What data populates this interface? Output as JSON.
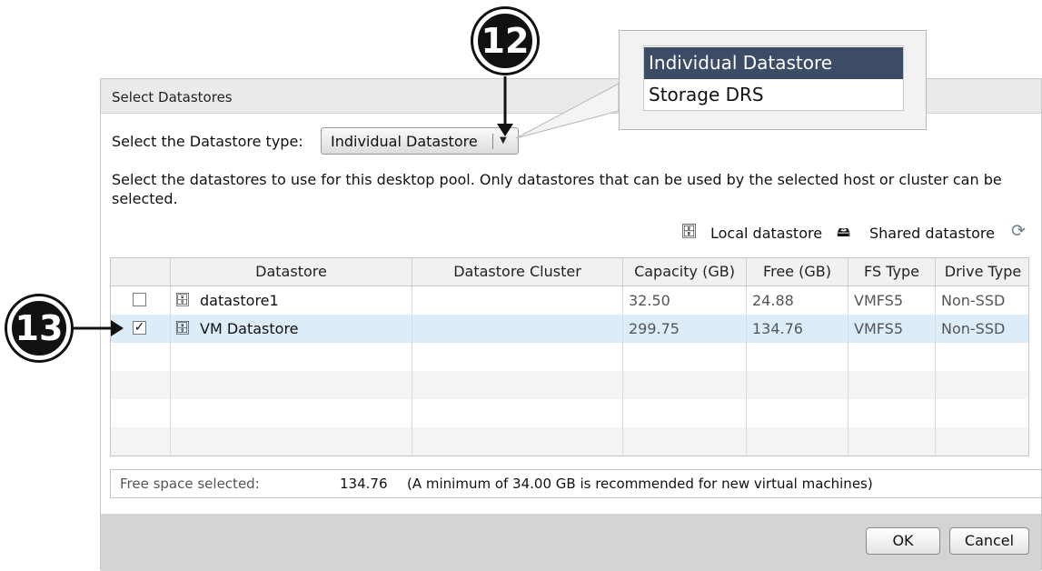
{
  "dialog": {
    "title": "Select Datastores",
    "type_label": "Select the Datastore type:",
    "type_value": "Individual Datastore",
    "description": "Select the datastores to use for this desktop pool. Only datastores that can be used by the selected host or cluster can be selected.",
    "legend_local": "Local datastore",
    "legend_shared": "Shared datastore"
  },
  "dropdown": {
    "options": [
      {
        "label": "Individual Datastore",
        "selected": true
      },
      {
        "label": "Storage DRS",
        "selected": false
      }
    ]
  },
  "table": {
    "headers": [
      "Datastore",
      "Datastore Cluster",
      "Capacity (GB)",
      "Free (GB)",
      "FS Type",
      "Drive Type"
    ],
    "rows": [
      {
        "checked": "",
        "name": "datastore1",
        "cluster": "",
        "capacity": "32.50",
        "free": "24.88",
        "fs": "VMFS5",
        "drive": "Non-SSD"
      },
      {
        "checked": "✓",
        "name": "VM Datastore",
        "cluster": "",
        "capacity": "299.75",
        "free": "134.76",
        "fs": "VMFS5",
        "drive": "Non-SSD"
      }
    ]
  },
  "free_space": {
    "label": "Free space selected:",
    "value": "134.76",
    "note": "(A minimum of 34.00 GB is recommended for new virtual machines)"
  },
  "buttons": {
    "ok": "OK",
    "cancel": "Cancel"
  },
  "callouts": {
    "a": "12",
    "b": "13"
  },
  "icons": {
    "local_datastore": "local-datastore-icon",
    "shared_datastore": "shared-datastore-icon",
    "refresh": "refresh-icon",
    "dropdown_arrow": "chevron-down-icon"
  },
  "colors": {
    "selected_row": "#dcecf8",
    "selected_option": "#3c4c66"
  }
}
